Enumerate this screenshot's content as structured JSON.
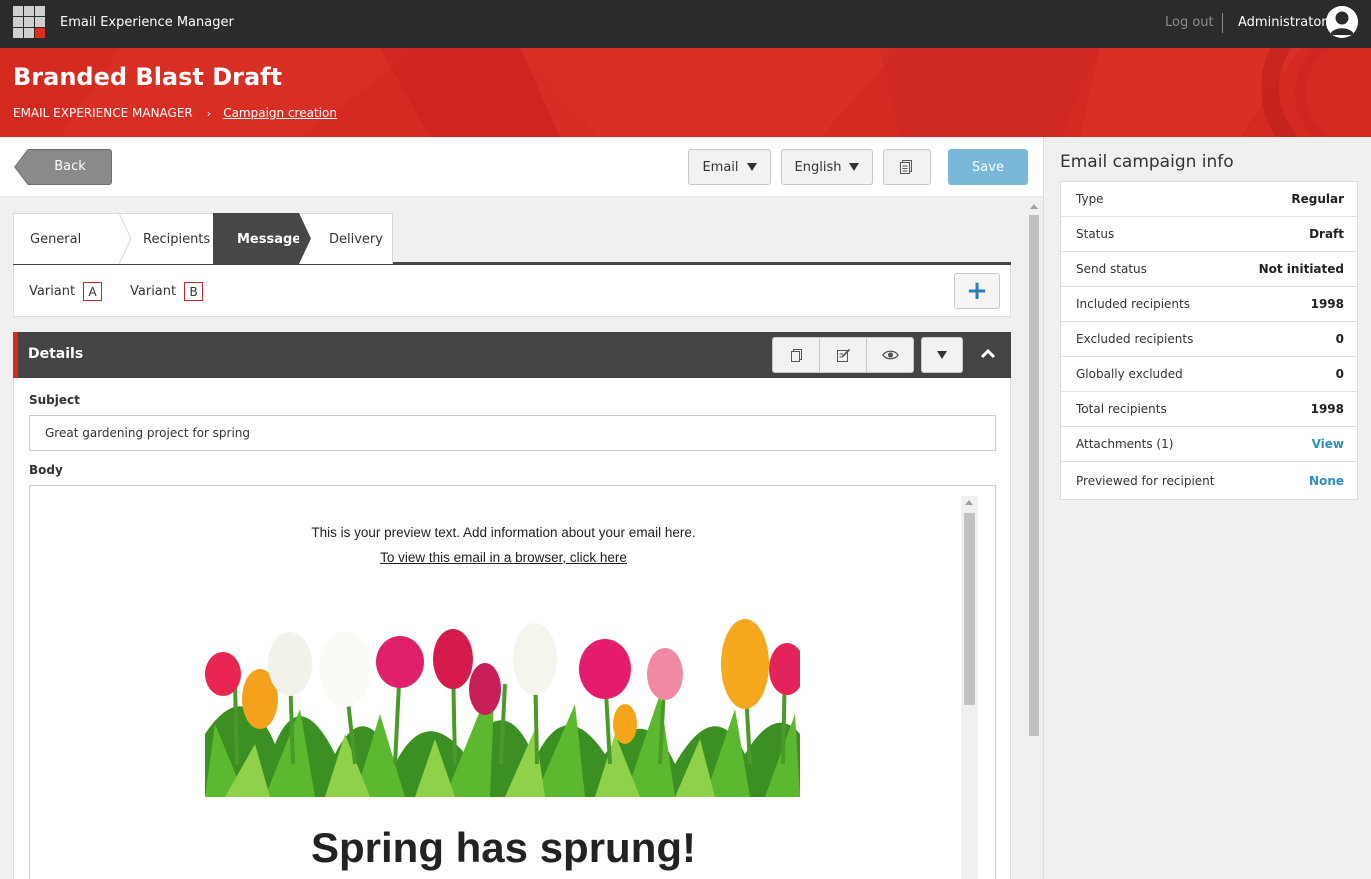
{
  "app": {
    "name": "Email Experience Manager"
  },
  "topbar": {
    "logout_label": "Log out",
    "user_name": "Administrator"
  },
  "header": {
    "title": "Branded Blast Draft",
    "breadcrumb": {
      "root": "EMAIL EXPERIENCE MANAGER",
      "separator": "›",
      "current": "Campaign creation"
    }
  },
  "toolbar": {
    "back_label": "Back",
    "channel_select": "Email",
    "language_select": "English",
    "save_label": "Save"
  },
  "tabs": [
    {
      "label": "General",
      "active": false
    },
    {
      "label": "Recipients",
      "active": false
    },
    {
      "label": "Message",
      "active": true
    },
    {
      "label": "Delivery",
      "active": false
    }
  ],
  "variants": {
    "label": "Variant",
    "items": [
      "A",
      "B"
    ],
    "add_label": "+"
  },
  "details": {
    "title": "Details",
    "subject_label": "Subject",
    "subject_value": "Great gardening project for spring",
    "body_label": "Body",
    "email": {
      "preview_text": "This is your preview text. Add information about your email here.",
      "browser_link": "To view this email in a browser, click here",
      "headline": "Spring has sprung!"
    }
  },
  "campaign_info": {
    "title": "Email campaign info",
    "rows": [
      {
        "label": "Type",
        "value": "Regular",
        "link": false
      },
      {
        "label": "Status",
        "value": "Draft",
        "link": false
      },
      {
        "label": "Send status",
        "value": "Not initiated",
        "link": false
      },
      {
        "label": "Included recipients",
        "value": "1998",
        "link": false
      },
      {
        "label": "Excluded recipients",
        "value": "0",
        "link": false
      },
      {
        "label": "Globally excluded",
        "value": "0",
        "link": false
      },
      {
        "label": "Total recipients",
        "value": "1998",
        "link": false
      },
      {
        "label": "Attachments (1)",
        "value": "View",
        "link": true
      },
      {
        "label": "Previewed for recipient",
        "value": "None",
        "link": true
      }
    ]
  },
  "colors": {
    "topbar": "#2b2b2b",
    "brand_red": "#d42a22",
    "tab_active": "#474747",
    "save_button": "#7ab8d9",
    "link_blue": "#2f8fc4"
  }
}
